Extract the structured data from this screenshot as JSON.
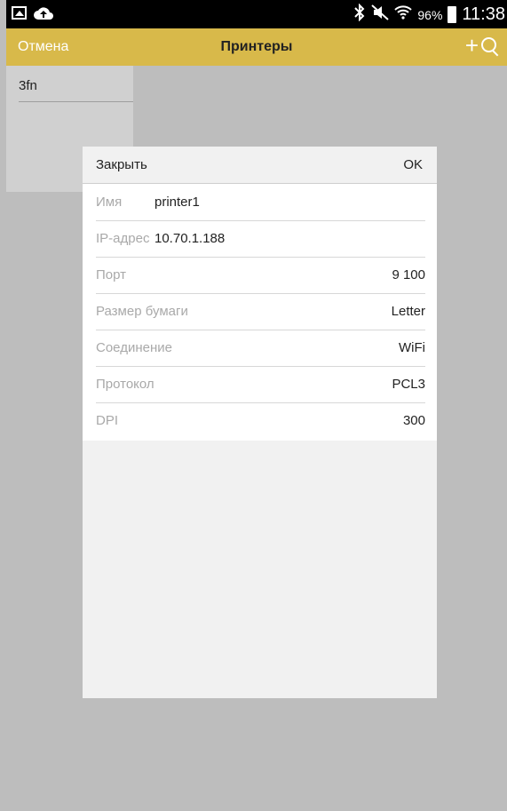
{
  "status_bar": {
    "left_icons": [
      "gallery-icon",
      "cloud-upload-icon"
    ],
    "right_icons": [
      "bluetooth-icon",
      "mute-icon",
      "wifi-icon"
    ],
    "battery_percent": "96%",
    "time": "11:38"
  },
  "toolbar": {
    "cancel_label": "Отмена",
    "title": "Принтеры",
    "add_label": "+",
    "accent_color": "#d8b94a"
  },
  "list": {
    "items": [
      "3fn"
    ]
  },
  "dialog": {
    "close_label": "Закрыть",
    "ok_label": "OK",
    "fields": [
      {
        "label": "Имя",
        "value": "printer1"
      },
      {
        "label": "IP-адрес",
        "value": "10.70.1.188"
      },
      {
        "label": "Порт",
        "value": "9 100"
      },
      {
        "label": "Размер бумаги",
        "value": "Letter"
      },
      {
        "label": "Соединение",
        "value": "WiFi"
      },
      {
        "label": "Протокол",
        "value": "PCL3"
      },
      {
        "label": "DPI",
        "value": "300"
      }
    ]
  }
}
